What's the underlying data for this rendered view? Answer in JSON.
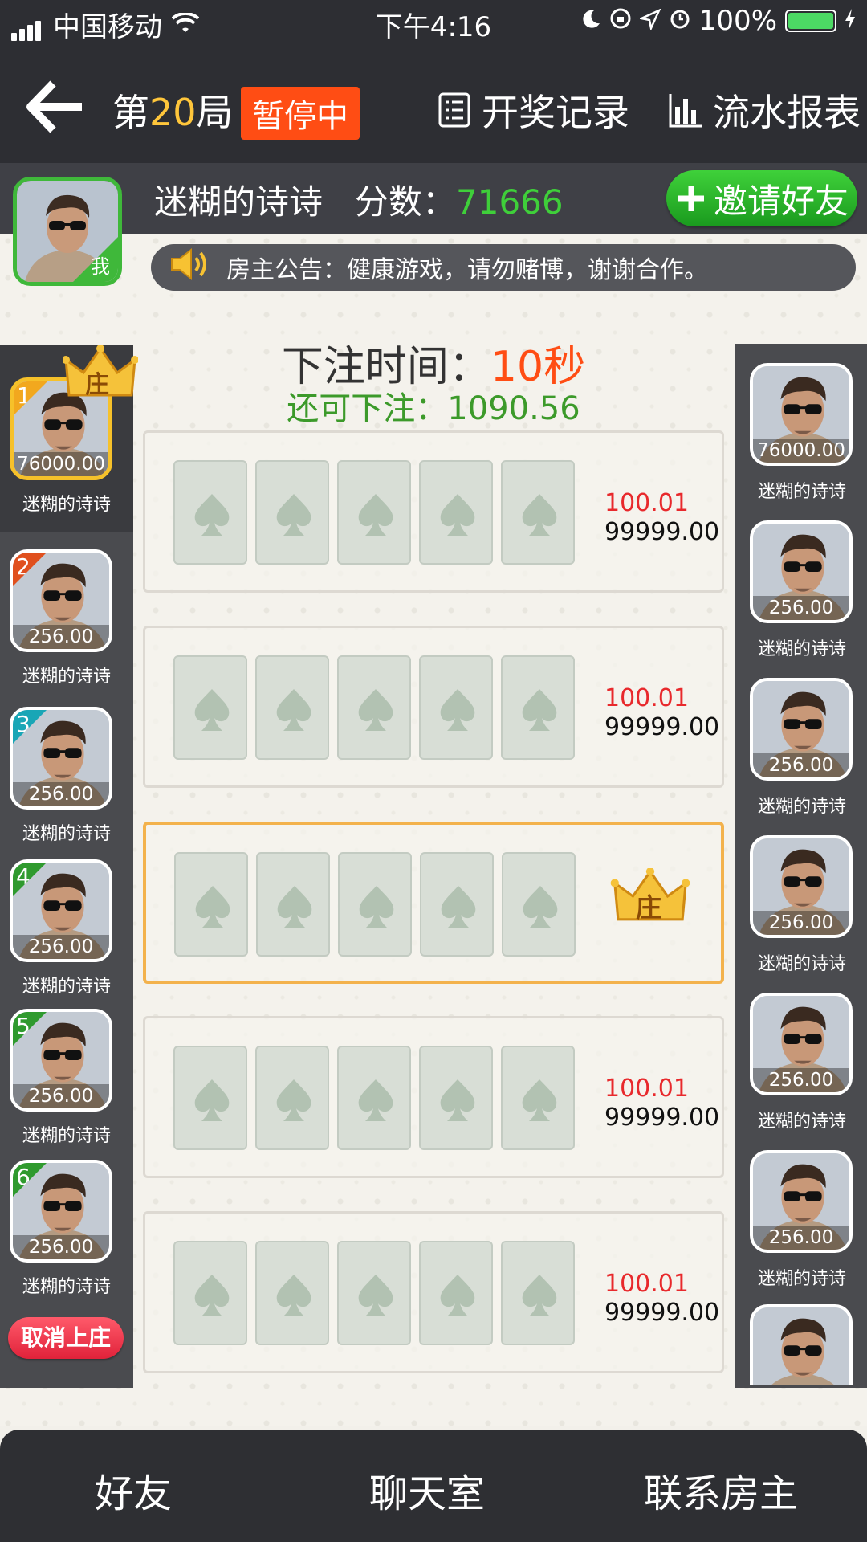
{
  "status_bar": {
    "carrier": "中国移动",
    "time": "下午4:16",
    "battery": "100%"
  },
  "header": {
    "round_prefix": "第",
    "round_number": "20",
    "round_suffix": "局",
    "state_badge": "暂停中",
    "records_label": "开奖记录",
    "report_label": "流水报表"
  },
  "user": {
    "name": "迷糊的诗诗",
    "score_label": "分数：",
    "score": "71666",
    "me_tag": "我",
    "invite_label": "邀请好友"
  },
  "notice": {
    "text": "房主公告：健康游戏，请勿赌博，谢谢合作。"
  },
  "betting": {
    "time_label": "下注时间：",
    "time_value": "10秒",
    "remain_label": "还可下注：",
    "remain_value": "1090.56"
  },
  "banker_tag": "庄",
  "left_players": [
    {
      "rank": "1",
      "score": "76000.00",
      "name": "迷糊的诗诗"
    },
    {
      "rank": "2",
      "score": "256.00",
      "name": "迷糊的诗诗"
    },
    {
      "rank": "3",
      "score": "256.00",
      "name": "迷糊的诗诗"
    },
    {
      "rank": "4",
      "score": "256.00",
      "name": "迷糊的诗诗"
    },
    {
      "rank": "5",
      "score": "256.00",
      "name": "迷糊的诗诗"
    },
    {
      "rank": "6",
      "score": "256.00",
      "name": "迷糊的诗诗"
    }
  ],
  "right_players": [
    {
      "score": "76000.00",
      "name": "迷糊的诗诗"
    },
    {
      "score": "256.00",
      "name": "迷糊的诗诗"
    },
    {
      "score": "256.00",
      "name": "迷糊的诗诗"
    },
    {
      "score": "256.00",
      "name": "迷糊的诗诗"
    },
    {
      "score": "256.00",
      "name": "迷糊的诗诗"
    },
    {
      "score": "256.00",
      "name": "迷糊的诗诗"
    }
  ],
  "cancel_label": "取消上庄",
  "rows": [
    {
      "odds": "100.01",
      "stake": "99999.00"
    },
    {
      "odds": "100.01",
      "stake": "99999.00"
    },
    {
      "banker": true
    },
    {
      "odds": "100.01",
      "stake": "99999.00"
    },
    {
      "odds": "100.01",
      "stake": "99999.00"
    }
  ],
  "bottom_nav": [
    "好友",
    "聊天室",
    "联系房主"
  ],
  "colors": {
    "accent_green": "#3fcf3a",
    "accent_orange": "#ff4d14",
    "gold": "#f3b24c",
    "dark": "#2d2e33"
  }
}
